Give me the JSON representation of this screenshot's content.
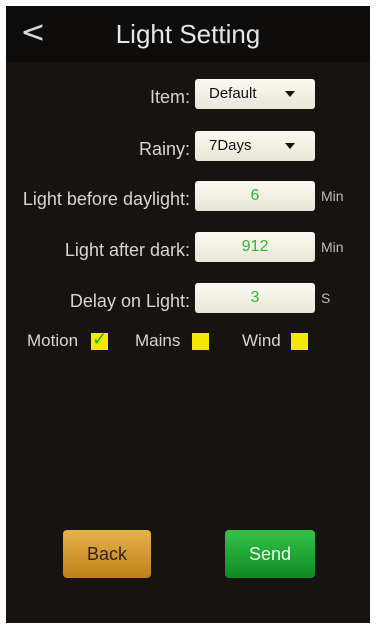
{
  "header": {
    "back_glyph": "<",
    "title": "Light Setting"
  },
  "form": {
    "item": {
      "label": "Item:",
      "value": "Default"
    },
    "rainy": {
      "label": "Rainy:",
      "value": "7Days"
    },
    "light_before_daylight": {
      "label": "Light before daylight:",
      "value": "6",
      "unit": "Min"
    },
    "light_after_dark": {
      "label": "Light after dark:",
      "value": "912",
      "unit": "Min"
    },
    "delay_on_light": {
      "label": "Delay on Light:",
      "value": "3",
      "unit": "S"
    }
  },
  "checks": {
    "motion": {
      "label": "Motion",
      "checked": true
    },
    "mains": {
      "label": "Mains",
      "checked": false
    },
    "wind": {
      "label": "Wind",
      "checked": false
    }
  },
  "buttons": {
    "back_label": "Back",
    "send_label": "Send"
  },
  "colors": {
    "background": "#161311",
    "field_bg": "#f6f4e8",
    "field_value": "#2db82d",
    "checkbox": "#f5e800",
    "back_button": "#d69a30",
    "send_button": "#22a836"
  },
  "icons": {
    "back": "chevron-left-icon",
    "dropdown": "caret-down-icon",
    "check": "check-mark-icon"
  }
}
